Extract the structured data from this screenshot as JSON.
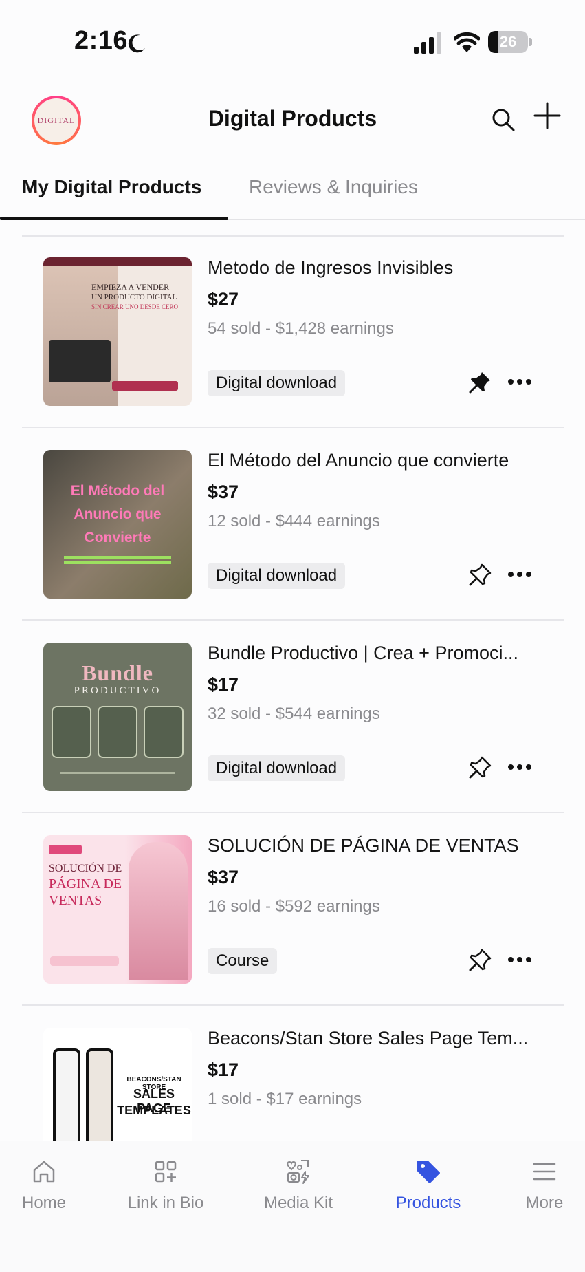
{
  "status_bar": {
    "time": "2:16",
    "battery": "26",
    "battery_level": 0.26
  },
  "header": {
    "title": "Digital Products",
    "brand": "DIGITAL"
  },
  "tabs": [
    {
      "label": "My Digital Products",
      "active": true
    },
    {
      "label": "Reviews & Inquiries",
      "active": false
    }
  ],
  "products": [
    {
      "title": "Metodo de Ingresos Invisibles",
      "price": "$27",
      "stats": "54 sold - $1,428 earnings",
      "type": "Digital download",
      "pinned": true,
      "thumb": {
        "line1": "EMPIEZA A VENDER",
        "line2": "UN PRODUCTO DIGITAL",
        "line3": "SIN CREAR UNO DESDE CERO"
      }
    },
    {
      "title": "El Método del Anuncio que convierte",
      "price": "$37",
      "stats": "12 sold - $444 earnings",
      "type": "Digital download",
      "pinned": false,
      "thumb": {
        "line1": "El Método del",
        "line2": "Anuncio que",
        "line3": "Convierte"
      }
    },
    {
      "title": "Bundle Productivo | Crea + Promoci...",
      "price": "$17",
      "stats": "32 sold - $544 earnings",
      "type": "Digital download",
      "pinned": false,
      "thumb": {
        "line1": "Bundle",
        "line2": "PRODUCTIVO",
        "line3": ""
      }
    },
    {
      "title": "SOLUCIÓN DE PÁGINA DE VENTAS",
      "price": "$37",
      "stats": "16 sold - $592 earnings",
      "type": "Course",
      "pinned": false,
      "thumb": {
        "line1": "SOLUCIÓN DE",
        "line2": "PÁGINA DE",
        "line3": "VENTAS"
      }
    },
    {
      "title": "Beacons/Stan Store Sales Page Tem...",
      "price": "$17",
      "stats": "1 sold - $17 earnings",
      "type": "",
      "pinned": false,
      "thumb": {
        "line1": "BEACONS/STAN STORE",
        "line2": "SALES PAGE",
        "line3": "TEMPLATES"
      }
    }
  ],
  "bottom_nav": [
    {
      "label": "Home",
      "icon": "home-icon",
      "active": false
    },
    {
      "label": "Link in Bio",
      "icon": "link-in-bio-icon",
      "active": false
    },
    {
      "label": "Media Kit",
      "icon": "media-kit-icon",
      "active": false
    },
    {
      "label": "Products",
      "icon": "tag-icon",
      "active": true
    },
    {
      "label": "More",
      "icon": "menu-icon",
      "active": false
    }
  ],
  "colors": {
    "accent": "#3554e0",
    "divider": "#e6e6ea",
    "muted": "#8a8a8e"
  }
}
